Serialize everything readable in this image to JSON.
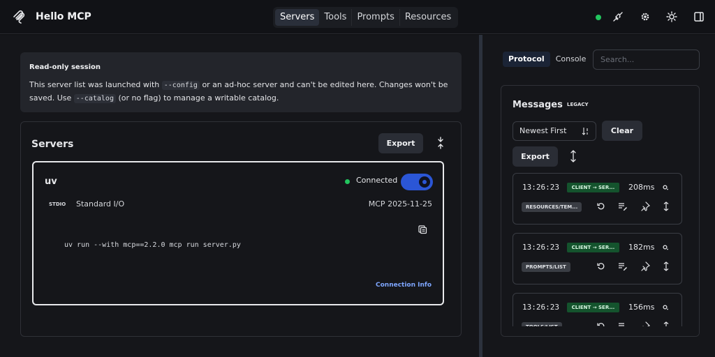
{
  "app": {
    "title": "Hello MCP"
  },
  "nav": {
    "tabs": [
      "Servers",
      "Tools",
      "Prompts",
      "Resources"
    ],
    "active": "Servers"
  },
  "colors": {
    "connected": "#22c55e",
    "accent": "#2b56d6",
    "link": "#7ea6ff",
    "direction_badge": "#14532d"
  },
  "notice": {
    "title": "Read-only session",
    "line1_a": "This server list was launched with",
    "line1_code": "--config",
    "line1_b": "or an ad-hoc server and can't be edited here. Changes won't be saved. Use",
    "line2_code": "--catalog",
    "line2_b": "(or no flag) to manage a writable catalog."
  },
  "servers": {
    "title": "Servers",
    "export_label": "Export",
    "server": {
      "name": "uv",
      "status": "Connected",
      "enabled": true,
      "transport_badge": "STDIO",
      "transport": "Standard I/O",
      "protocol_version": "MCP 2025-11-25",
      "command": "uv run --with mcp==2.2.0 mcp run server.py",
      "connection_info_label": "Connection Info"
    }
  },
  "inspector": {
    "tabs": [
      "Protocol",
      "Console"
    ],
    "active_tab": "Protocol",
    "search_placeholder": "Search...",
    "messages_title": "Messages",
    "legacy_label": "LEGACY",
    "sort_value": "Newest First",
    "clear_label": "Clear",
    "export_label": "Export",
    "messages": [
      {
        "time": "13:26:23",
        "direction": "CLIENT → SER...",
        "latency": "208ms",
        "method": "RESOURCES/TEM..."
      },
      {
        "time": "13:26:23",
        "direction": "CLIENT → SER...",
        "latency": "182ms",
        "method": "PROMPTS/LIST"
      },
      {
        "time": "13:26:23",
        "direction": "CLIENT → SER...",
        "latency": "156ms",
        "method": "TOOLS/LIST"
      }
    ]
  }
}
